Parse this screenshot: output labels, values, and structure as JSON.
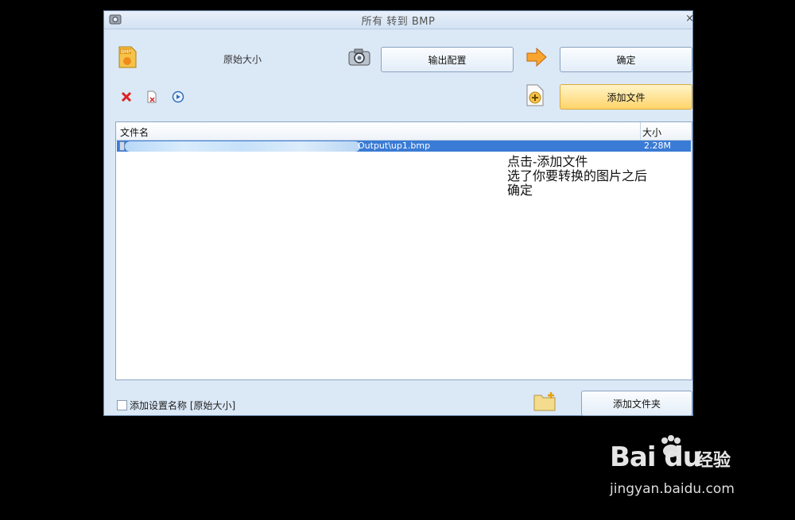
{
  "window": {
    "title": "所有 转到 BMP",
    "close_glyph": "×"
  },
  "toolbar": {
    "size_label": "原始大小",
    "output_config_label": "输出配置",
    "ok_label": "确定",
    "add_file_label": "添加文件"
  },
  "list": {
    "columns": {
      "name": "文件名",
      "size": "大小"
    },
    "rows": [
      {
        "path": "Output\\up1.bmp",
        "size": "2.28M"
      }
    ]
  },
  "annotation": {
    "lines": [
      "点击-添加文件",
      "选了你要转换的图片之后",
      "确定"
    ]
  },
  "footer": {
    "checkbox_label": "添加设置名称 [原始大小]",
    "add_folder_label": "添加文件夹"
  },
  "watermark": {
    "brand": "Bai du",
    "suffix": "经验",
    "url": "jingyan.baidu.com"
  },
  "colors": {
    "selected_row": "#3a7bd5",
    "add_button": "#ffd46a",
    "window_bg": "#dbe8f6"
  }
}
